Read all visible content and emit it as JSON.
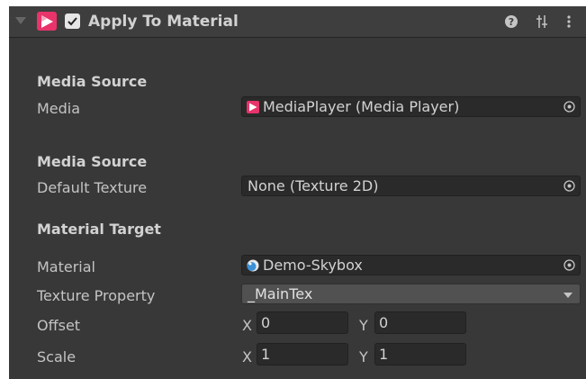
{
  "component": {
    "title": "Apply To Material",
    "enabled": true,
    "icons": {
      "foldout": "foldout-arrow-icon",
      "component": "avpro-media-icon",
      "help": "help-icon",
      "presets": "presets-icon",
      "menu": "kebab-menu-icon"
    }
  },
  "sections": {
    "media_source_1": "Media Source",
    "media_source_2": "Media Source",
    "material_target": "Material Target"
  },
  "fields": {
    "media": {
      "label": "Media",
      "value": "MediaPlayer (Media Player)",
      "icon": "media-player-icon"
    },
    "default_texture": {
      "label": "Default Texture",
      "value": "None (Texture 2D)"
    },
    "material": {
      "label": "Material",
      "value": "Demo-Skybox",
      "icon": "material-sphere-icon"
    },
    "texture_property": {
      "label": "Texture Property",
      "value": "_MainTex"
    },
    "offset": {
      "label": "Offset",
      "x_label": "X",
      "x": "0",
      "y_label": "Y",
      "y": "0"
    },
    "scale": {
      "label": "Scale",
      "x_label": "X",
      "x": "1",
      "y_label": "Y",
      "y": "1"
    }
  },
  "colors": {
    "panel_bg": "#383838",
    "field_bg": "#2a2a2a",
    "accent": "#e8336b"
  }
}
